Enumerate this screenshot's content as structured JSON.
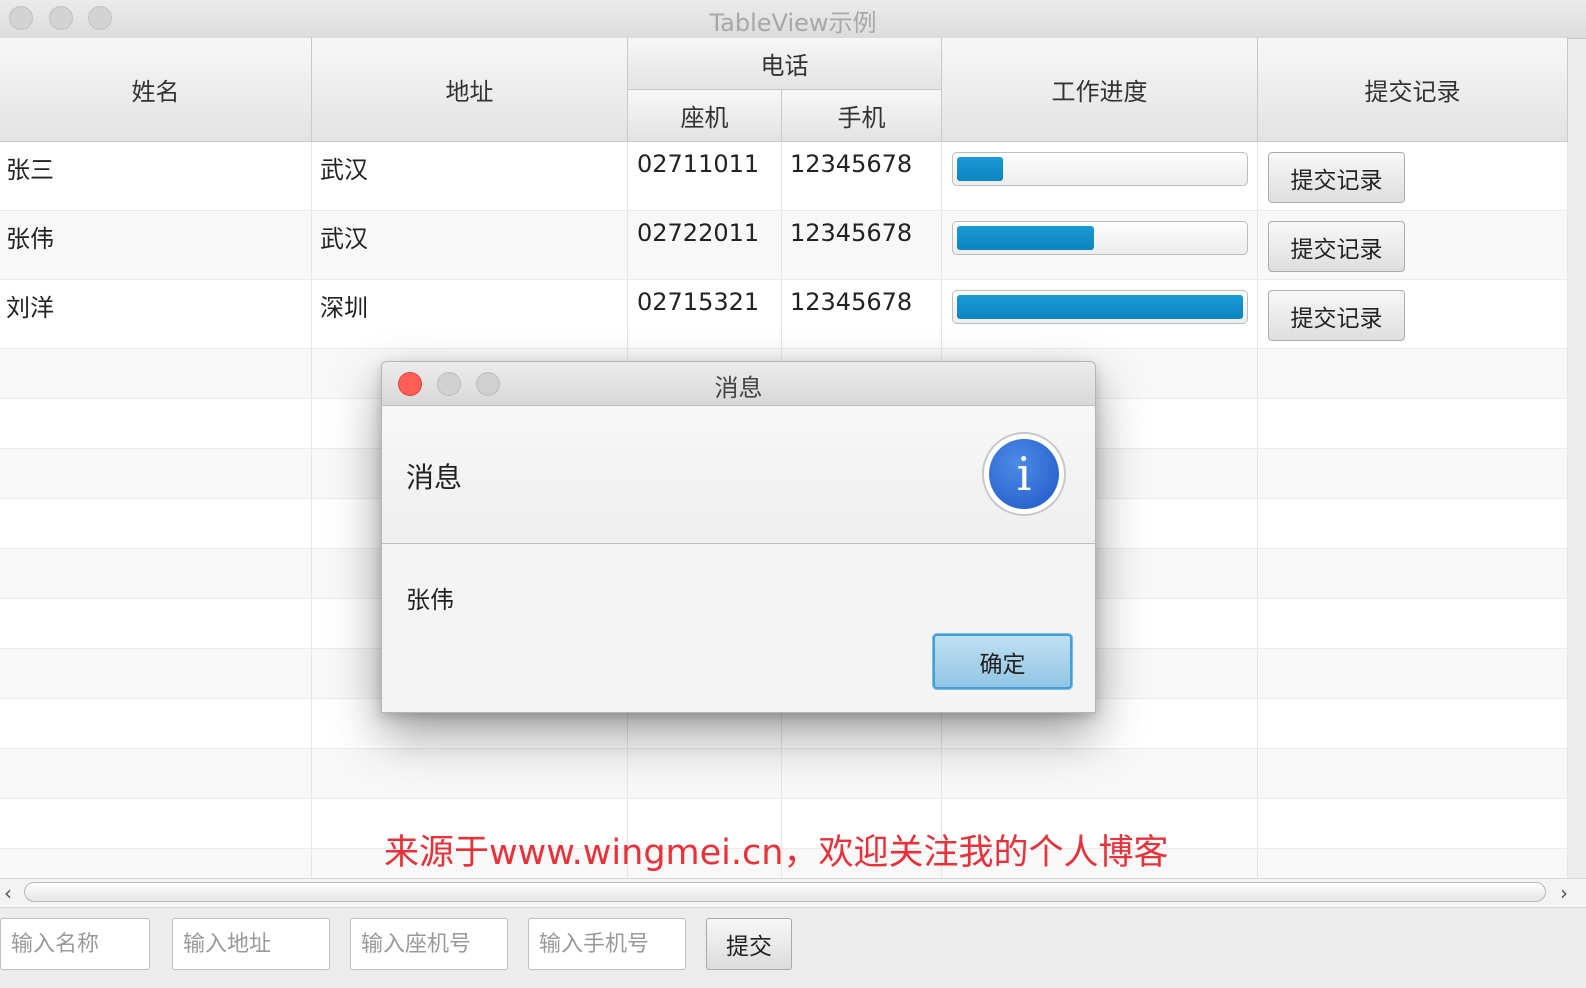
{
  "window": {
    "title": "TableView示例"
  },
  "table": {
    "columns": {
      "name": "姓名",
      "address": "地址",
      "phone": "电话",
      "landline": "座机",
      "mobile": "手机",
      "progress": "工作进度",
      "submit_record": "提交记录"
    },
    "rows": [
      {
        "name": "张三",
        "address": "武汉",
        "landline": "02711011",
        "mobile": "12345678",
        "progress": 0.16,
        "button": "提交记录"
      },
      {
        "name": "张伟",
        "address": "武汉",
        "landline": "02722011",
        "mobile": "12345678",
        "progress": 0.48,
        "button": "提交记录"
      },
      {
        "name": "刘洋",
        "address": "深圳",
        "landline": "02715321",
        "mobile": "12345678",
        "progress": 1.0,
        "button": "提交记录"
      }
    ]
  },
  "form": {
    "name_placeholder": "输入名称",
    "address_placeholder": "输入地址",
    "landline_placeholder": "输入座机号",
    "mobile_placeholder": "输入手机号",
    "submit_label": "提交"
  },
  "watermark": "来源于www.wingmei.cn，欢迎关注我的个人博客",
  "dialog": {
    "title": "消息",
    "header": "消息",
    "content": "张伟",
    "ok_label": "确定",
    "icon": "info-icon"
  },
  "colors": {
    "progress_fill": "#0b84bf",
    "close_button": "#ff5f57",
    "watermark": "#e8323a",
    "default_button_border": "#3fa0d8"
  }
}
